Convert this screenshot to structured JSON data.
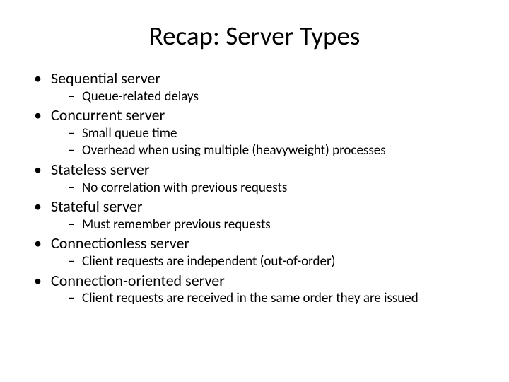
{
  "title": "Recap: Server Types",
  "items": [
    {
      "label": "Sequential server",
      "sub": [
        "Queue-related delays"
      ]
    },
    {
      "label": "Concurrent server",
      "sub": [
        "Small queue time",
        "Overhead when using multiple (heavyweight) processes"
      ]
    },
    {
      "label": "Stateless server",
      "sub": [
        "No correlation with previous requests"
      ]
    },
    {
      "label": "Stateful server",
      "sub": [
        "Must remember previous requests"
      ]
    },
    {
      "label": "Connectionless server",
      "sub": [
        "Client requests are independent (out-of-order)"
      ]
    },
    {
      "label": "Connection-oriented server",
      "sub": [
        "Client requests are received in the same order they are issued"
      ]
    }
  ]
}
